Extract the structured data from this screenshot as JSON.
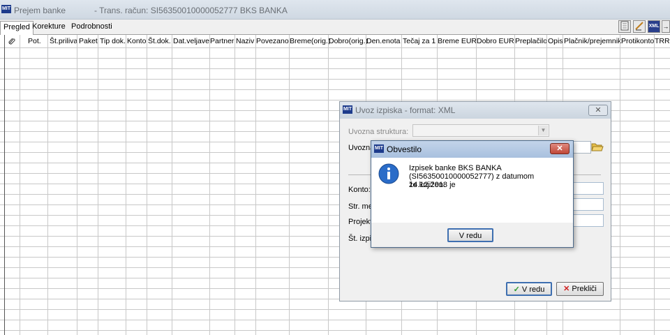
{
  "window": {
    "app_icon": "MIT",
    "title": "Prejem banke",
    "subtitle": "- Trans. račun: SI56350010000052777  BKS BANKA"
  },
  "tabs": [
    {
      "label": "Pregled",
      "active": true
    },
    {
      "label": "Korekture",
      "active": false
    },
    {
      "label": "Podrobnosti",
      "active": false
    }
  ],
  "toolbar": {
    "buttons": [
      {
        "icon": "page-icon"
      },
      {
        "icon": "edit-icon"
      },
      {
        "icon": "xml-icon",
        "label": "XML"
      },
      {
        "icon": "arrow-right-icon",
        "label": "→"
      }
    ]
  },
  "grid": {
    "columns": [
      "Pot.",
      "Št.priliva",
      "Paket",
      "Tip dok.",
      "Konto",
      "Št.dok.",
      "Dat.veljave",
      "Partner",
      "Naziv",
      "Povezano",
      "Breme(orig.)",
      "Dobro(orig.)",
      "Den.enota",
      "Tečaj za 1",
      "Breme EUR",
      "Dobro EUR",
      "Preplačilo",
      "Opis",
      "Plačnik/prejemnik",
      "Protikonto",
      "TRR"
    ],
    "attachment_icon": "paperclip-icon"
  },
  "import_dialog": {
    "title": "Uvoz izpiska - format: XML",
    "fields": {
      "struktura_label": "Uvozna struktura:",
      "uvozna_label": "Uvozna",
      "konto_label": "Konto:",
      "str_mes_label": "Str. mes",
      "projekt_label": "Projekt:",
      "st_izp_label": "Št. izpis"
    },
    "ok_label": "V redu",
    "cancel_label": "Prekliči"
  },
  "message_dialog": {
    "title": "Obvestilo",
    "message_line1": "Izpisek banke BKS BANKA",
    "message_line2": "(SI56350010000052777) z datumom 14.12.2018 je",
    "message_line3": "že knjižen.",
    "ok_label": "V redu",
    "icon": "info-icon"
  },
  "colors": {
    "close_red": "#c75050",
    "info_blue": "#1f5fbf",
    "title_active": "#a8c0de"
  }
}
